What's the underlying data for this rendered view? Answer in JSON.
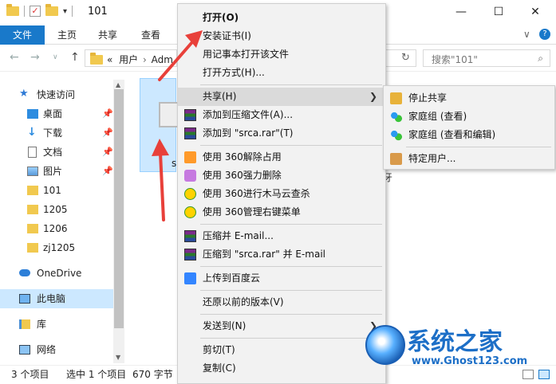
{
  "window": {
    "title": "101",
    "min": "—",
    "max": "☐",
    "close": "✕"
  },
  "ribbon": {
    "file": "文件",
    "tabs": [
      "主页",
      "共享",
      "查看"
    ],
    "chev": "∨",
    "help": "?"
  },
  "address": {
    "prefix": "«",
    "path": [
      "用户",
      "Adm"
    ],
    "search_placeholder": "搜索\"101\""
  },
  "sidebar": {
    "items": [
      {
        "label": "快速访问",
        "icon": "star-icon"
      },
      {
        "label": "桌面",
        "icon": "desktop-icon",
        "pinned": true
      },
      {
        "label": "下载",
        "icon": "download-icon",
        "pinned": true
      },
      {
        "label": "文档",
        "icon": "document-icon",
        "pinned": true
      },
      {
        "label": "图片",
        "icon": "picture-icon",
        "pinned": true
      },
      {
        "label": "101",
        "icon": "folder-icon"
      },
      {
        "label": "1205",
        "icon": "folder-icon"
      },
      {
        "label": "1206",
        "icon": "folder-icon"
      },
      {
        "label": "zj1205",
        "icon": "folder-icon"
      },
      {
        "label": "OneDrive",
        "icon": "cloud-icon"
      },
      {
        "label": "此电脑",
        "icon": "computer-icon",
        "selected": true
      },
      {
        "label": "库",
        "icon": "library-icon"
      },
      {
        "label": "网络",
        "icon": "network-icon"
      }
    ]
  },
  "files": {
    "selected_name": "s",
    "partial_text": "牙"
  },
  "status": {
    "count": "3 个项目",
    "selected": "选中 1 个项目",
    "size": "670 字节"
  },
  "context_menu": {
    "items": [
      {
        "label": "打开(O)",
        "bold": true
      },
      {
        "label": "安装证书(I)"
      },
      {
        "label": "用记事本打开该文件"
      },
      {
        "label": "打开方式(H)..."
      },
      {
        "label": "共享(H)",
        "submenu": true,
        "highlighted": true
      },
      {
        "label": "添加到压缩文件(A)...",
        "icon": "winrar-icon"
      },
      {
        "label": "添加到 \"srca.rar\"(T)",
        "icon": "winrar-icon"
      },
      {
        "label": "使用 360解除占用",
        "icon": "360-unlock-icon"
      },
      {
        "label": "使用 360强力删除",
        "icon": "360-delete-icon"
      },
      {
        "label": "使用 360进行木马云查杀",
        "icon": "360-scan-icon"
      },
      {
        "label": "使用 360管理右键菜单",
        "icon": "360-menu-icon"
      },
      {
        "label": "压缩并 E-mail...",
        "icon": "winrar-icon"
      },
      {
        "label": "压缩到 \"srca.rar\" 并 E-mail",
        "icon": "winrar-icon"
      },
      {
        "label": "上传到百度云",
        "icon": "baidu-cloud-icon"
      },
      {
        "label": "还原以前的版本(V)"
      },
      {
        "label": "发送到(N)",
        "submenu": true
      },
      {
        "label": "剪切(T)"
      },
      {
        "label": "复制(C)"
      }
    ],
    "submenu_arrow": "❯"
  },
  "share_submenu": {
    "items": [
      {
        "label": "停止共享",
        "icon": "lock-icon"
      },
      {
        "label": "家庭组 (查看)",
        "icon": "homegroup-icon"
      },
      {
        "label": "家庭组 (查看和编辑)",
        "icon": "homegroup-icon"
      },
      {
        "label": "特定用户...",
        "icon": "users-icon"
      }
    ]
  },
  "watermark": {
    "title": "系统之家",
    "url": "www.Ghost123.com"
  },
  "colors": {
    "accent": "#1979ca",
    "selection": "#cce8ff",
    "menu_bg": "#f2f2f2",
    "arrow": "#e8403a"
  }
}
